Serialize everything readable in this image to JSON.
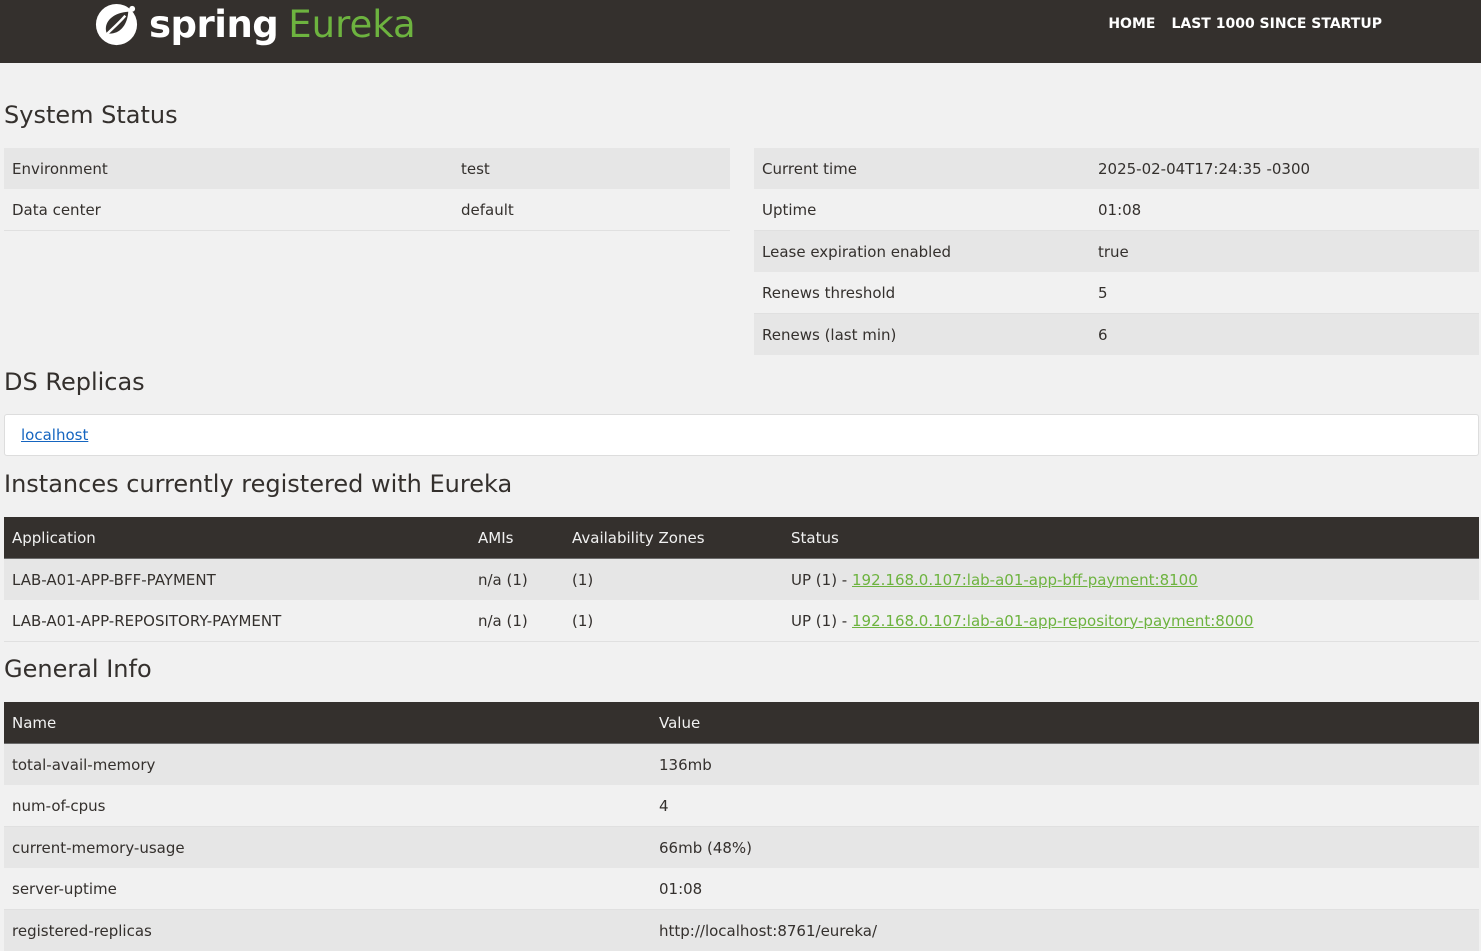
{
  "brand": {
    "spring": "spring",
    "eureka": "Eureka"
  },
  "nav": {
    "home": "HOME",
    "last1000": "LAST 1000 SINCE STARTUP"
  },
  "system_status": {
    "title": "System Status",
    "left": [
      {
        "label": "Environment",
        "value": "test"
      },
      {
        "label": "Data center",
        "value": "default"
      }
    ],
    "right": [
      {
        "label": "Current time",
        "value": "2025-02-04T17:24:35 -0300"
      },
      {
        "label": "Uptime",
        "value": "01:08"
      },
      {
        "label": "Lease expiration enabled",
        "value": "true"
      },
      {
        "label": "Renews threshold",
        "value": "5"
      },
      {
        "label": "Renews (last min)",
        "value": "6"
      }
    ]
  },
  "replicas": {
    "title": "DS Replicas",
    "items": [
      "localhost"
    ]
  },
  "instances": {
    "title": "Instances currently registered with Eureka",
    "headers": [
      "Application",
      "AMIs",
      "Availability Zones",
      "Status"
    ],
    "rows": [
      {
        "app": "LAB-A01-APP-BFF-PAYMENT",
        "amis": "n/a (1)",
        "zones": "(1)",
        "status_prefix": "UP (1) - ",
        "status_link": "192.168.0.107:lab-a01-app-bff-payment:8100"
      },
      {
        "app": "LAB-A01-APP-REPOSITORY-PAYMENT",
        "amis": "n/a (1)",
        "zones": "(1)",
        "status_prefix": "UP (1) - ",
        "status_link": "192.168.0.107:lab-a01-app-repository-payment:8000"
      }
    ]
  },
  "general_info": {
    "title": "General Info",
    "headers": [
      "Name",
      "Value"
    ],
    "rows": [
      {
        "name": "total-avail-memory",
        "value": "136mb"
      },
      {
        "name": "num-of-cpus",
        "value": "4"
      },
      {
        "name": "current-memory-usage",
        "value": "66mb (48%)"
      },
      {
        "name": "server-uptime",
        "value": "01:08"
      },
      {
        "name": "registered-replicas",
        "value": "http://localhost:8761/eureka/"
      }
    ]
  },
  "colors": {
    "nav_bg": "#34302d",
    "accent_green": "#6db33f",
    "page_bg": "#f1f1f1",
    "row_shade": "#e6e6e6",
    "link_blue": "#1565c0"
  },
  "icons": {
    "logo": "spring-leaf-logo-icon"
  }
}
